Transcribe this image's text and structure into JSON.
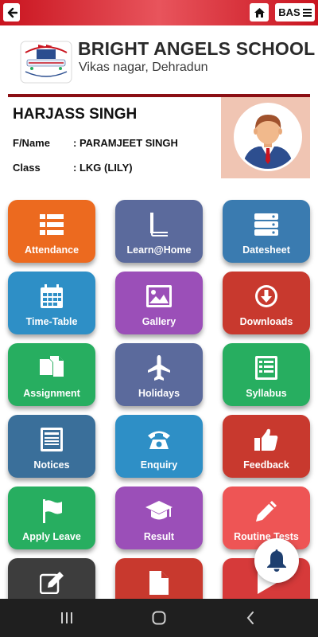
{
  "topbar": {
    "account_label": "BAS",
    "colors": {
      "bar": "#c9141f"
    }
  },
  "school": {
    "name": "BRIGHT ANGELS SCHOOL",
    "address": "Vikas nagar, Dehradun",
    "logo_name": "Bright Angels School"
  },
  "student": {
    "name": "HARJASS SINGH",
    "fname_label": "F/Name",
    "fname_value": ": PARAMJEET SINGH",
    "class_label": "Class",
    "class_value": ": LKG (LILY)"
  },
  "tiles": [
    {
      "label": "Attendance",
      "icon": "list-icon",
      "color": "#ec6a1f"
    },
    {
      "label": "Learn@Home",
      "icon": "book-icon",
      "color": "#5b6a9c"
    },
    {
      "label": "Datesheet",
      "icon": "server-icon",
      "color": "#3a7bb0"
    },
    {
      "label": "Time-Table",
      "icon": "calendar-icon",
      "color": "#2e8fc6"
    },
    {
      "label": "Gallery",
      "icon": "image-icon",
      "color": "#9b4fb8"
    },
    {
      "label": "Downloads",
      "icon": "download-icon",
      "color": "#c8392e"
    },
    {
      "label": "Assignment",
      "icon": "copy-icon",
      "color": "#27ae60"
    },
    {
      "label": "Holidays",
      "icon": "plane-icon",
      "color": "#5b6a9c"
    },
    {
      "label": "Syllabus",
      "icon": "list-alt-icon",
      "color": "#27ae60"
    },
    {
      "label": "Notices",
      "icon": "newspaper-icon",
      "color": "#3a6f9a"
    },
    {
      "label": "Enquiry",
      "icon": "phone-icon",
      "color": "#2e8fc6"
    },
    {
      "label": "Feedback",
      "icon": "thumbs-up-icon",
      "color": "#c8392e"
    },
    {
      "label": "Apply Leave",
      "icon": "flag-icon",
      "color": "#27ae60"
    },
    {
      "label": "Result",
      "icon": "graduation-cap-icon",
      "color": "#9b4fb8"
    },
    {
      "label": "Routine Tests",
      "icon": "pencil-icon",
      "color": "#ee5555"
    },
    {
      "label": "",
      "icon": "edit-icon",
      "color": "#3d3d3d"
    },
    {
      "label": "",
      "icon": "file-icon",
      "color": "#c8392e"
    },
    {
      "label": "",
      "icon": "play-icon",
      "color": "#d63a3a"
    }
  ],
  "fab": {
    "icon": "bell-icon",
    "color": "#1e3f6f"
  },
  "navbar": {
    "recent_icon": "recent-apps-icon",
    "home_icon": "home-nav-icon",
    "back_icon": "back-nav-icon"
  }
}
